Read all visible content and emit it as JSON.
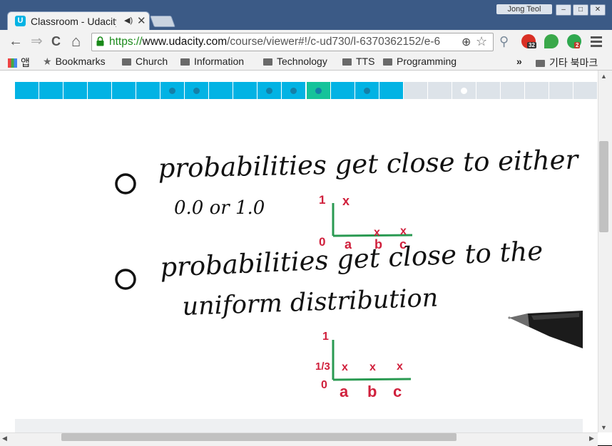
{
  "window": {
    "user_name": "Jong Teol",
    "minimize_glyph": "–",
    "maximize_glyph": "□",
    "close_glyph": "✕"
  },
  "tab": {
    "favicon_letter": "U",
    "title": "Classroom - Udacity",
    "audio_glyph": "◀)",
    "close_glyph": "✕"
  },
  "toolbar": {
    "back_glyph": "←",
    "forward_glyph": "⇒",
    "reload_glyph": "C",
    "home_glyph": "⌂",
    "url_scheme": "https://",
    "url_host": "www.udacity.com",
    "url_path": "/course/viewer#!/c-ud730/l-6370362152/e-6",
    "zoom_glyph": "⊕",
    "star_glyph": "☆",
    "search_glyph": "⚲",
    "ext1_badge": "32",
    "ext3_badge": "2"
  },
  "bookmarks": {
    "apps_label": "앱",
    "items": [
      "Bookmarks",
      "Church",
      "Information",
      "Technology",
      "TTS",
      "Programming"
    ],
    "overflow": "»",
    "other_label": "기타 북마크"
  },
  "progress": {
    "segments_total": 24,
    "segments_completed": 16,
    "current_segment": 12,
    "dotted_completed": [
      6,
      7,
      10,
      11,
      12,
      14
    ],
    "dotted_pending": [
      18
    ],
    "colors": {
      "done": "#02b3e4",
      "current": "#15c39a",
      "pending": "#dde3e9",
      "dot_done": "#1480a8",
      "dot_pending": "#ffffff"
    }
  },
  "quiz": {
    "option1_line1": "probabilities get close to either",
    "option1_line2": "0.0 or 1.0",
    "option2_line1": "probabilities get close to the",
    "option2_line2": "uniform distribution",
    "graph1": {
      "y_top": "1",
      "origin": "0",
      "x_labels": [
        "a",
        "b",
        "c"
      ],
      "mark": "x"
    },
    "graph2": {
      "y_top": "1",
      "y_mid": "1/3",
      "origin": "0",
      "x_labels": [
        "a",
        "b",
        "c"
      ],
      "mark": "x"
    },
    "colors": {
      "ink": "#111111",
      "axis": "#2a9a52",
      "annot": "#d0203c"
    }
  },
  "scroll": {
    "up": "▲",
    "down": "▼",
    "left": "◀",
    "right": "▶"
  }
}
